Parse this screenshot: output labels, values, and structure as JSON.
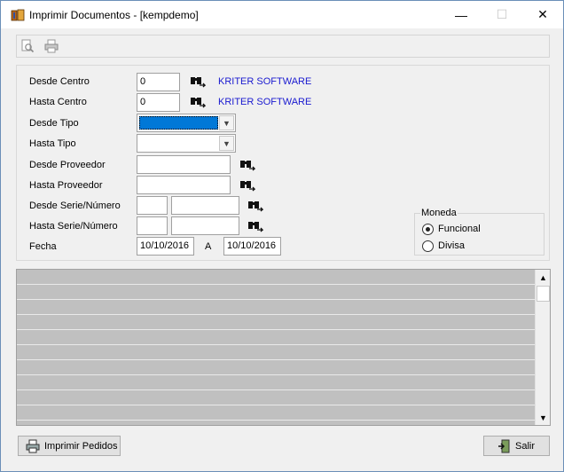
{
  "window": {
    "title": "Imprimir Documentos - [kempdemo]",
    "minimize_glyph": "—",
    "maximize_glyph": "☐",
    "close_glyph": "✕"
  },
  "toolbar": {
    "items": [
      {
        "icon": "print-preview-icon"
      },
      {
        "icon": "printer-icon"
      }
    ]
  },
  "form": {
    "desde_centro": {
      "label": "Desde Centro",
      "value": "0",
      "name": "KRITER SOFTWARE"
    },
    "hasta_centro": {
      "label": "Hasta Centro",
      "value": "0",
      "name": "KRITER SOFTWARE"
    },
    "desde_tipo": {
      "label": "Desde Tipo",
      "value": ""
    },
    "hasta_tipo": {
      "label": "Hasta Tipo",
      "value": ""
    },
    "desde_proveedor": {
      "label": "Desde Proveedor",
      "value": ""
    },
    "hasta_proveedor": {
      "label": "Hasta Proveedor",
      "value": ""
    },
    "desde_serie": {
      "label": "Desde Serie/Número",
      "serie": "",
      "numero": ""
    },
    "hasta_serie": {
      "label": "Hasta Serie/Número",
      "serie": "",
      "numero": ""
    },
    "fecha": {
      "label": "Fecha",
      "from": "10/10/2016",
      "separator": "A",
      "to": "10/10/2016"
    }
  },
  "moneda": {
    "title": "Moneda",
    "options": [
      {
        "label": "Funcional",
        "selected": true
      },
      {
        "label": "Divisa",
        "selected": false
      }
    ]
  },
  "grid": {
    "rows": 10
  },
  "buttons": {
    "imprimir": "Imprimir Pedidos",
    "salir": "Salir"
  },
  "colors": {
    "selection": "#0078d7",
    "link": "#1a1ad0",
    "grid_bg": "#c0c0c0"
  }
}
